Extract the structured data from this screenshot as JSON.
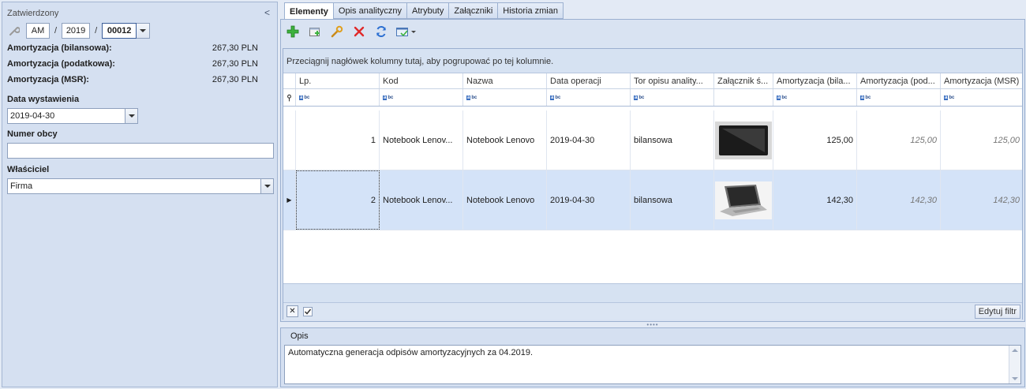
{
  "left": {
    "status": "Zatwierdzony",
    "collapse_glyph": "<",
    "number": {
      "prefix": "AM",
      "year": "2019",
      "seq": "00012",
      "sep": "/"
    },
    "amortization": [
      {
        "label": "Amortyzacja (bilansowa):",
        "value": "267,30 PLN"
      },
      {
        "label": "Amortyzacja (podatkowa):",
        "value": "267,30 PLN"
      },
      {
        "label": "Amortyzacja (MSR):",
        "value": "267,30 PLN"
      }
    ],
    "issue_date_label": "Data wystawienia",
    "issue_date": "2019-04-30",
    "foreign_number_label": "Numer obcy",
    "foreign_number": "",
    "owner_label": "Właściciel",
    "owner": "Firma"
  },
  "tabs": [
    "Elementy",
    "Opis analityczny",
    "Atrybuty",
    "Załączniki",
    "Historia zmian"
  ],
  "toolbar_icons": [
    "add-icon",
    "add-from-list-icon",
    "edit-wrench-icon",
    "delete-icon",
    "refresh-icon",
    "export-icon"
  ],
  "grid": {
    "group_hint": "Przeciągnij nagłówek kolumny tutaj, aby pogrupować po tej kolumnie.",
    "columns": [
      "Lp.",
      "Kod",
      "Nazwa",
      "Data operacji",
      "Tor opisu anality...",
      "Załącznik ś...",
      "Amortyzacja (bila...",
      "Amortyzacja (pod...",
      "Amortyzacja (MSR)"
    ],
    "rows": [
      {
        "lp": "1",
        "kod": "Notebook Lenov...",
        "nazwa": "Notebook Lenovo",
        "data": "2019-04-30",
        "tor": "bilansowa",
        "bil": "125,00",
        "pod": "125,00",
        "msr": "125,00"
      },
      {
        "lp": "2",
        "kod": "Notebook Lenov...",
        "nazwa": "Notebook Lenovo",
        "data": "2019-04-30",
        "tor": "bilansowa",
        "bil": "142,30",
        "pod": "142,30",
        "msr": "142,30"
      }
    ],
    "edit_filter": "Edytuj filtr"
  },
  "opis": {
    "label": "Opis",
    "text": "Automatyczna generacja odpisów amortyzacyjnych za 04.2019."
  },
  "colors": {
    "panel": "#d5e0f1",
    "selected_row": "#d4e3f8",
    "accent": "#3a6fc1"
  }
}
